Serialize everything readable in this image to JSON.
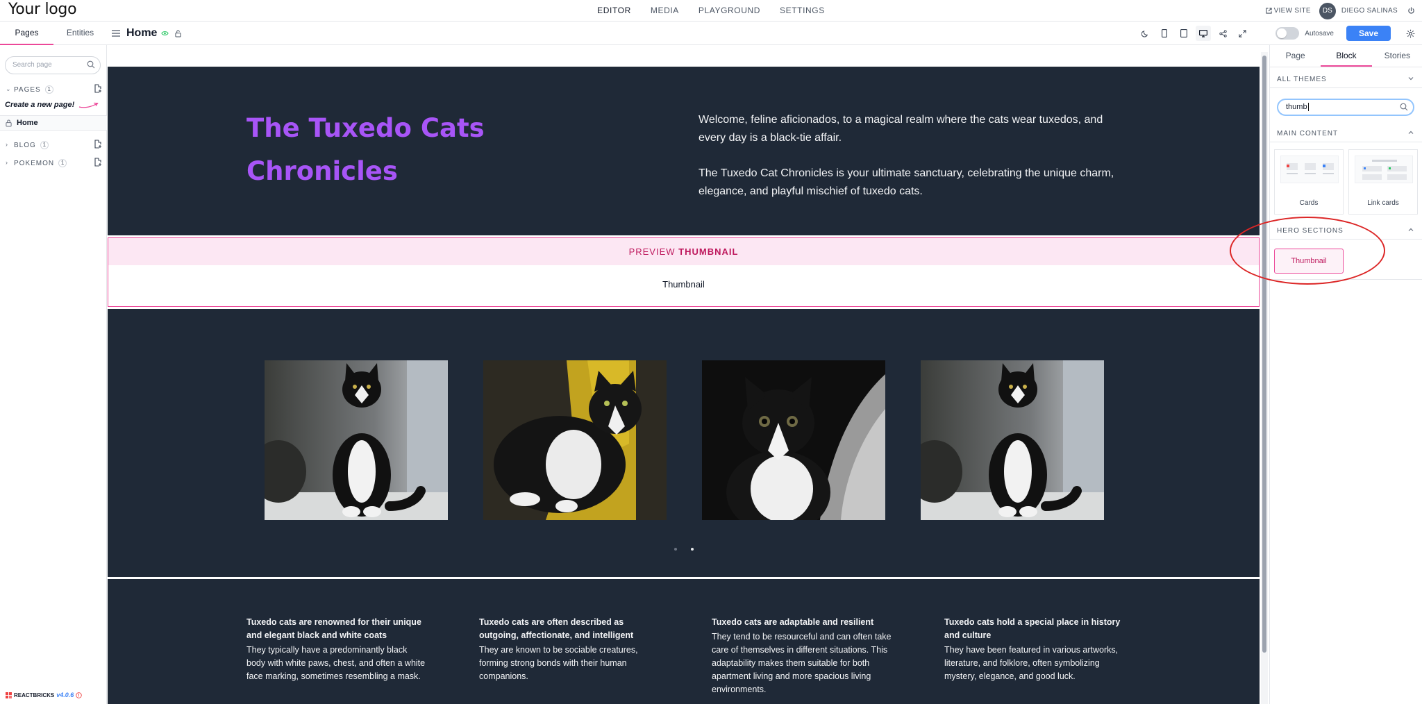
{
  "logo": "Your logo",
  "nav": {
    "items": [
      "EDITOR",
      "MEDIA",
      "PLAYGROUND",
      "SETTINGS"
    ],
    "active": "EDITOR"
  },
  "user": {
    "view_site": "VIEW SITE",
    "initials": "DS",
    "name": "DIEGO SALINAS"
  },
  "left_tabs": [
    "Pages",
    "Entities"
  ],
  "page": {
    "title": "Home"
  },
  "toolbar": {
    "autosave_label": "Autosave",
    "save_label": "Save"
  },
  "sidebar": {
    "search_placeholder": "Search page",
    "sections": [
      {
        "label": "PAGES",
        "count": "1"
      },
      {
        "label": "BLOG",
        "count": "1"
      },
      {
        "label": "POKEMON",
        "count": "1"
      }
    ],
    "create_hint": "Create a new page!",
    "home_item": "Home",
    "brand": "REACTBRICKS",
    "version": "v4.0.6"
  },
  "hero": {
    "title": "The Tuxedo Cats Chronicles",
    "paragraph1": "Welcome, feline aficionados, to a magical realm where the cats wear tuxedos, and every day is a black-tie affair.",
    "paragraph2": "The Tuxedo Cat Chronicles is your ultimate sanctuary, celebrating the unique charm, elegance, and playful mischief of tuxedo cats.",
    "color": "#a855f7"
  },
  "preview": {
    "prefix": "PREVIEW",
    "name": "THUMBNAIL",
    "body": "Thumbnail"
  },
  "features": [
    {
      "title": "Tuxedo cats are renowned for their unique and elegant black and white coats",
      "desc": "They typically have a predominantly black body with white paws, chest, and often a white face marking, sometimes resembling a mask."
    },
    {
      "title": "Tuxedo cats are often described as outgoing, affectionate, and intelligent",
      "desc": "They are known to be sociable creatures, forming strong bonds with their human companions."
    },
    {
      "title": "Tuxedo cats are adaptable and resilient",
      "desc": "They tend to be resourceful and can often take care of themselves in different situations. This adaptability makes them suitable for both apartment living and more spacious living environments."
    },
    {
      "title": "Tuxedo cats hold a special place in history and culture",
      "desc": "They have been featured in various artworks, literature, and folklore, often symbolizing mystery, elegance, and good luck."
    }
  ],
  "right_panel": {
    "tabs": [
      "Page",
      "Block",
      "Stories"
    ],
    "active_tab": "Block",
    "themes_label": "ALL THEMES",
    "search_value": "thumb",
    "main_content_label": "MAIN CONTENT",
    "blocks": [
      "Cards",
      "Link cards"
    ],
    "hero_sections_label": "HERO SECTIONS",
    "hero_block": "Thumbnail"
  },
  "colors": {
    "accent": "#ec4899",
    "primary": "#3b82f6",
    "dark_bg": "#1f2937",
    "annotation": "#dc2626"
  }
}
